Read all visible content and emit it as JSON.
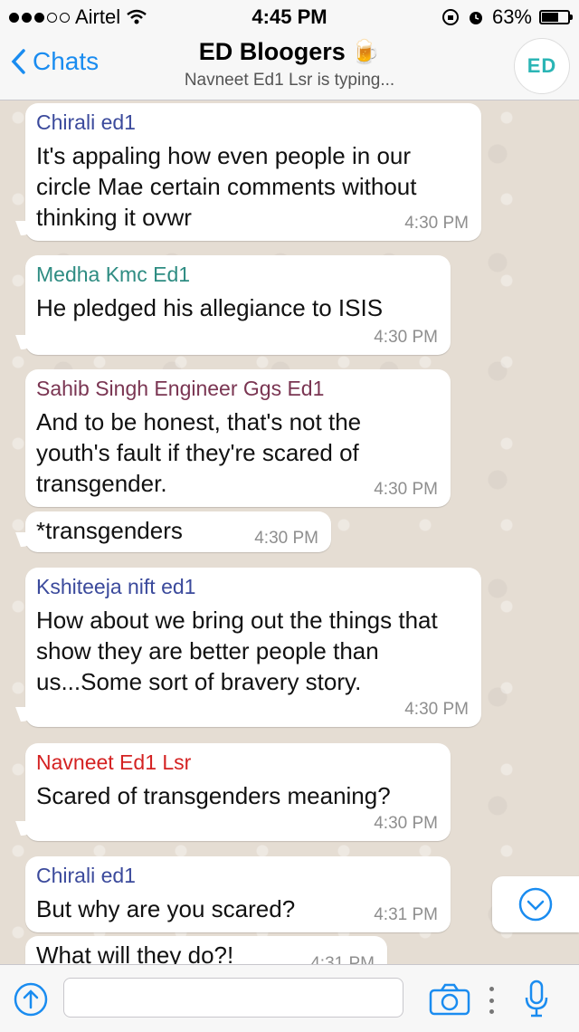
{
  "status_bar": {
    "carrier": "Airtel",
    "time": "4:45 PM",
    "battery": "63%",
    "battery_level": 0.63
  },
  "header": {
    "back_label": "Chats",
    "title": "ED Bloogers",
    "subtitle": "Navneet Ed1 Lsr is typing...",
    "avatar_text": "ED"
  },
  "messages": [
    {
      "sender": "Chirali ed1",
      "sender_color": "#3b4a9c",
      "text": "It's appaling how even people in our circle Mae certain comments without  thinking it ovwr",
      "time": "4:30 PM"
    },
    {
      "sender": "Medha Kmc Ed1",
      "sender_color": "#2e8c82",
      "text": "He pledged his allegiance to ISIS",
      "time": "4:30 PM"
    },
    {
      "sender": "Sahib Singh Engineer Ggs Ed1",
      "sender_color": "#7a3552",
      "text": "And to be honest, that's not the youth's fault if they're scared of transgender.",
      "time": "4:30 PM"
    },
    {
      "sender": "",
      "sender_color": "",
      "text": "*transgenders",
      "time": "4:30 PM"
    },
    {
      "sender": "Kshiteeja nift ed1",
      "sender_color": "#3b4a9c",
      "text": "How about we bring out the things that show they are better people than us...Some sort of bravery story.",
      "time": "4:30 PM"
    },
    {
      "sender": "Navneet Ed1 Lsr",
      "sender_color": "#d42222",
      "text": "Scared of transgenders meaning?",
      "time": "4:30 PM"
    },
    {
      "sender": "Chirali ed1",
      "sender_color": "#3b4a9c",
      "text": "But why are you scared?",
      "time": "4:31 PM"
    },
    {
      "sender": "",
      "sender_color": "",
      "text": "What will they do?!",
      "time": "4:31 PM"
    }
  ],
  "input": {
    "value": "",
    "placeholder": ""
  },
  "colors": {
    "accent": "#1a8cf0"
  }
}
